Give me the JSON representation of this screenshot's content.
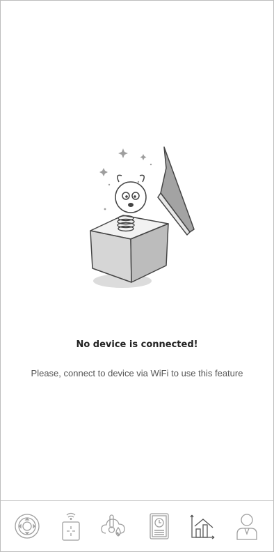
{
  "empty_state": {
    "title": "No device is connected!",
    "message": "Please, connect to device via WiFi to use this feature",
    "illustration": "jack-in-the-box-icon"
  },
  "tab_bar": {
    "active_index": 4,
    "tabs": [
      {
        "icon": "joystick-icon"
      },
      {
        "icon": "remote-control-icon"
      },
      {
        "icon": "cloud-temperature-icon"
      },
      {
        "icon": "report-icon"
      },
      {
        "icon": "statistics-chart-icon"
      },
      {
        "icon": "user-profile-icon"
      }
    ]
  },
  "colors": {
    "border": "#bdbdbd",
    "icon": "#9e9e9e",
    "active_icon": "#555555",
    "title": "#222222",
    "subtitle": "#555555"
  }
}
